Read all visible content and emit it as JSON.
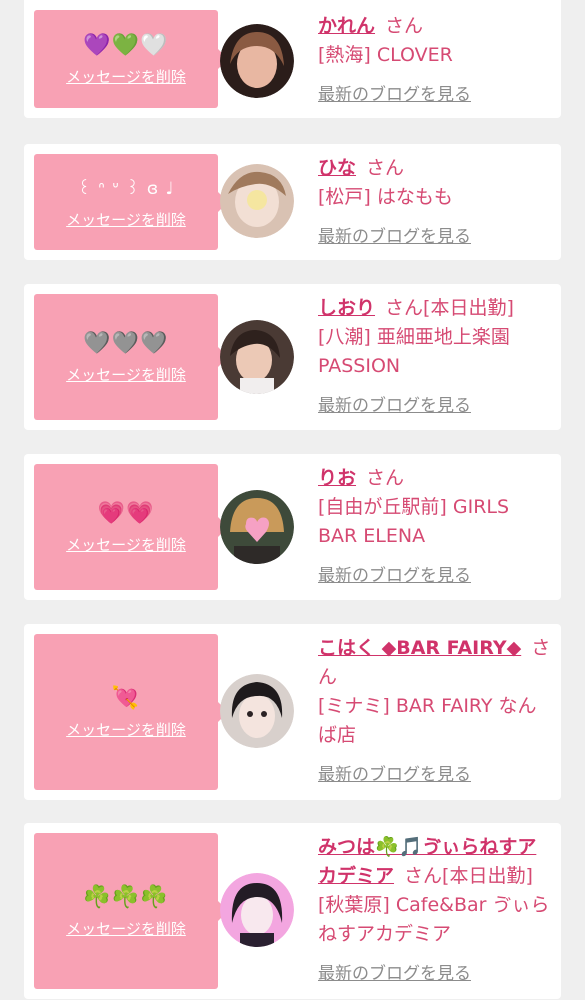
{
  "cards": [
    {
      "emoji": "💜💚🤍",
      "delete_label": "メッセージを削除",
      "name": "かれん",
      "honorific": "さん",
      "status": "",
      "shop": "[熱海] CLOVER",
      "blog_label": "最新のブログを見る",
      "avatar_color": "#6a4a3e"
    },
    {
      "emoji": "꒰ ᐢ ᐡ ꒱ ɞ ♩",
      "delete_label": "メッセージを削除",
      "name": "ひな",
      "honorific": "さん",
      "status": "",
      "shop": "[松戸] はなもも",
      "blog_label": "最新のブログを見る",
      "avatar_color": "#c9ab96"
    },
    {
      "emoji": "🩶🩶🩶",
      "delete_label": "メッセージを削除",
      "name": "しおり",
      "honorific": "さん",
      "status": "[本日出勤]",
      "shop": "[八潮] 亜細亜地上楽園 PASSION",
      "blog_label": "最新のブログを見る",
      "avatar_color": "#7b5a4e"
    },
    {
      "emoji": "💗💗",
      "delete_label": "メッセージを削除",
      "name": "りお",
      "honorific": "さん",
      "status": "",
      "shop": "[自由が丘駅前] GIRLS BAR ELENA",
      "blog_label": "最新のブログを見る",
      "avatar_color": "#b88a52"
    },
    {
      "emoji": "💘",
      "delete_label": "メッセージを削除",
      "name": "こはく ◆BAR FAIRY◆",
      "honorific": "さん",
      "status": "",
      "shop": "[ミナミ] BAR FAIRY なんば店",
      "blog_label": "最新のブログを見る",
      "avatar_color": "#3a3336"
    },
    {
      "emoji": "☘️☘️☘️",
      "delete_label": "メッセージを削除",
      "name": "みつは☘️🎵ゔぃらねすアカデミア",
      "honorific": "さん",
      "status": "[本日出勤]",
      "shop": "[秋葉原] Cafe&Bar ゔぃらねすアカデミア",
      "blog_label": "最新のブログを見る",
      "avatar_color": "#e78ed0"
    }
  ]
}
